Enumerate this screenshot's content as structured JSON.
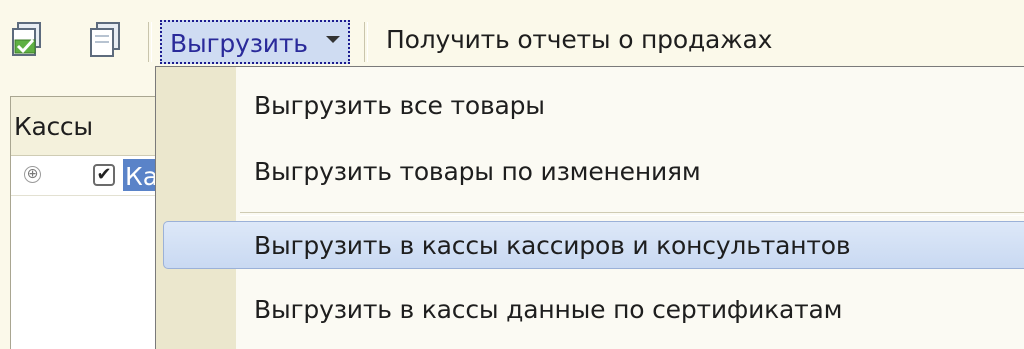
{
  "toolbar": {
    "icons": [
      "checked-copy-icon",
      "copy-icon"
    ],
    "dropdown_label": "Выгрузить",
    "reports_label": "Получить отчеты о продажах"
  },
  "panel": {
    "header_title": "Кассы",
    "tree_row": {
      "expander": "⊕",
      "checkbox": "✔",
      "label": "Ка",
      "checked": true
    }
  },
  "menu": {
    "items": [
      {
        "label": "Выгрузить все товары"
      },
      {
        "label": "Выгрузить товары по изменениям"
      },
      {
        "label": "Выгрузить в кассы кассиров и консультантов"
      },
      {
        "label": "Выгрузить в кассы данные по сертификатам"
      }
    ],
    "highlighted_index": 2
  },
  "colors": {
    "background": "#fbf9ea",
    "highlight": "#c9d9f2",
    "selection": "#5a83c8",
    "gutter": "#ebe7cd"
  }
}
